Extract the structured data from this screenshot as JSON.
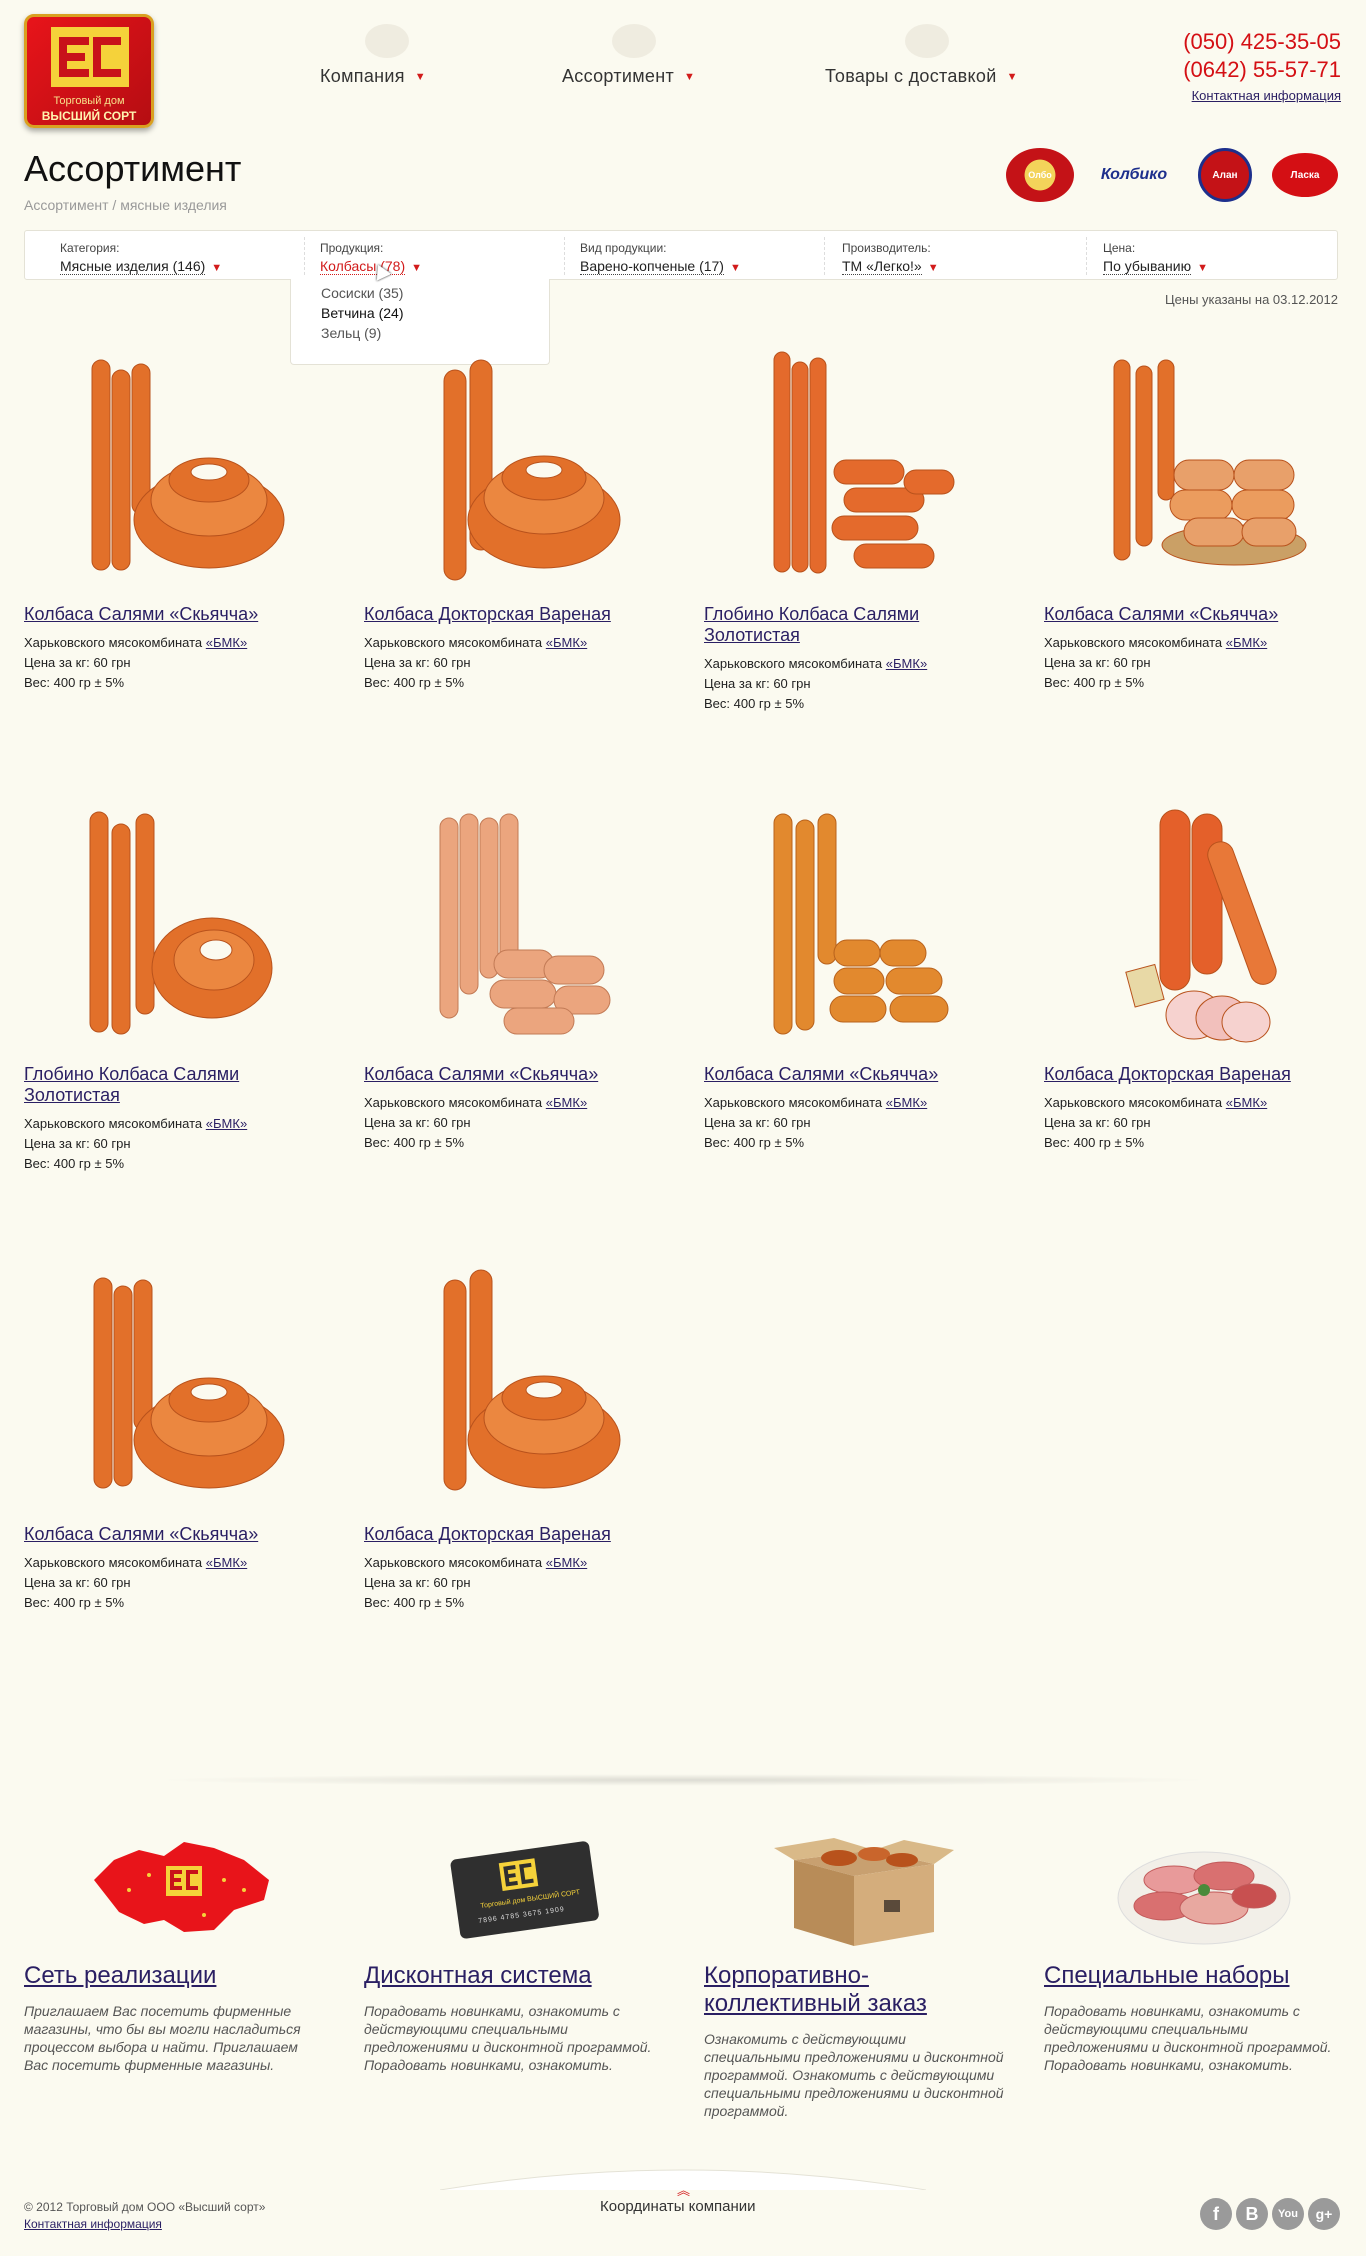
{
  "header": {
    "logo": {
      "line1": "Торговый дом",
      "line2": "ВЫСШИЙ СОРТ"
    },
    "nav": [
      {
        "label": "Компания"
      },
      {
        "label": "Ассортимент"
      },
      {
        "label": "Товары с доставкой"
      }
    ],
    "phones": [
      "(050) 425-35-05",
      "(0642) 55-57-71"
    ],
    "contact_link": "Контактная информация"
  },
  "page": {
    "title": "Ассортимент",
    "breadcrumb": "Ассортимент / мясные изделия"
  },
  "brands": [
    "Олбо",
    "Колбико",
    "Алан",
    "Ласка"
  ],
  "filters": [
    {
      "label": "Категория:",
      "value": "Мясные изделия (146)"
    },
    {
      "label": "Продукция:",
      "value": "Колбасы (78)"
    },
    {
      "label": "Вид продукции:",
      "value": "Варено-копченые (17)"
    },
    {
      "label": "Производитель:",
      "value": "ТМ «Легко!»"
    },
    {
      "label": "Цена:",
      "value": "По убыванию"
    }
  ],
  "dropdown": {
    "options": [
      "Сосиски (35)",
      "Ветчина (24)",
      "Зельц (9)"
    ]
  },
  "price_date": "Цены указаны на 03.12.2012",
  "products": [
    {
      "title": "Колбаса Салями «Скьяччa»",
      "maker": "Харьковского мясокомбината",
      "maker_link": "«БМК»",
      "price": "Цена за кг: 60 грн",
      "weight": "Вес: 400 гр ± 5%"
    },
    {
      "title": "Колбаса Докторская Вареная",
      "maker": "Харьковского мясокомбината",
      "maker_link": "«БМК»",
      "price": "Цена за кг: 60 грн",
      "weight": "Вес: 400 гр ± 5%"
    },
    {
      "title": "Глобино Колбаса Салями Золотистая",
      "maker": "Харьковского мясокомбината",
      "maker_link": "«БМК»",
      "price": "Цена за кг: 60 грн",
      "weight": "Вес: 400 гр ± 5%"
    },
    {
      "title": "Колбаса Салями «Скьяччa»",
      "maker": "Харьковского мясокомбината",
      "maker_link": "«БМК»",
      "price": "Цена за кг: 60 грн",
      "weight": "Вес: 400 гр ± 5%"
    },
    {
      "title": "Глобино Колбаса Салями Золотистая",
      "maker": "Харьковского мясокомбината",
      "maker_link": "«БМК»",
      "price": "Цена за кг: 60 грн",
      "weight": "Вес: 400 гр ± 5%"
    },
    {
      "title": "Колбаса Салями «Скьяччa»",
      "maker": "Харьковского мясокомбината",
      "maker_link": "«БМК»",
      "price": "Цена за кг: 60 грн",
      "weight": "Вес: 400 гр ± 5%"
    },
    {
      "title": "Колбаса Салями «Скьяччa»",
      "maker": "Харьковского мясокомбината",
      "maker_link": "«БМК»",
      "price": "Цена за кг: 60 грн",
      "weight": "Вес: 400 гр ± 5%"
    },
    {
      "title": "Колбаса Докторская Вареная",
      "maker": "Харьковского мясокомбината",
      "maker_link": "«БМК»",
      "price": "Цена за кг: 60 грн",
      "weight": "Вес: 400 гр ± 5%"
    },
    {
      "title": "Колбаса Салями «Скьяччa»",
      "maker": "Харьковского мясокомбината",
      "maker_link": "«БМК»",
      "price": "Цена за кг: 60 грн",
      "weight": "Вес: 400 гр ± 5%"
    },
    {
      "title": "Колбаса Докторская Вареная",
      "maker": "Харьковского мясокомбината",
      "maker_link": "«БМК»",
      "price": "Цена за кг: 60 грн",
      "weight": "Вес: 400 гр ± 5%"
    }
  ],
  "features": [
    {
      "title": "Сеть реализации",
      "desc": "Приглашаем Вас посетить фирменные магазины, что бы вы могли насладиться процессом выбора и найти. Приглашаем Вас посетить фирменные магазины."
    },
    {
      "title": "Дисконтная система",
      "desc": "Порадовать новинками, ознакомить с действующими специальными предложениями и дисконтной программой. Порадовать новинками, ознакомить.",
      "card_text": "Торговый дом ВЫСШИЙ СОРТ",
      "card_number": "7896 4785 3675 1909"
    },
    {
      "title": "Корпоративно-коллективный заказ",
      "desc": "Ознакомить с действующими специальными предложениями и дисконтной программой. Ознакомить с действующими специальными предложениями и дисконтной программой."
    },
    {
      "title": "Специальные наборы",
      "desc": "Порадовать новинками, ознакомить с действующими специальными предложениями и дисконтной программой. Порадовать новинками, ознакомить."
    }
  ],
  "footer": {
    "copyright": "© 2012 Торговый дом ООО «Высший сорт»",
    "contact_link": "Контактная информация",
    "coordinates": "Координаты компании",
    "social": [
      "f",
      "B",
      "You",
      "g+"
    ]
  },
  "colors": {
    "accent": "#d40f14",
    "link": "#2a1f63",
    "background": "#fbfaf0",
    "sausage": "#e2702a"
  }
}
